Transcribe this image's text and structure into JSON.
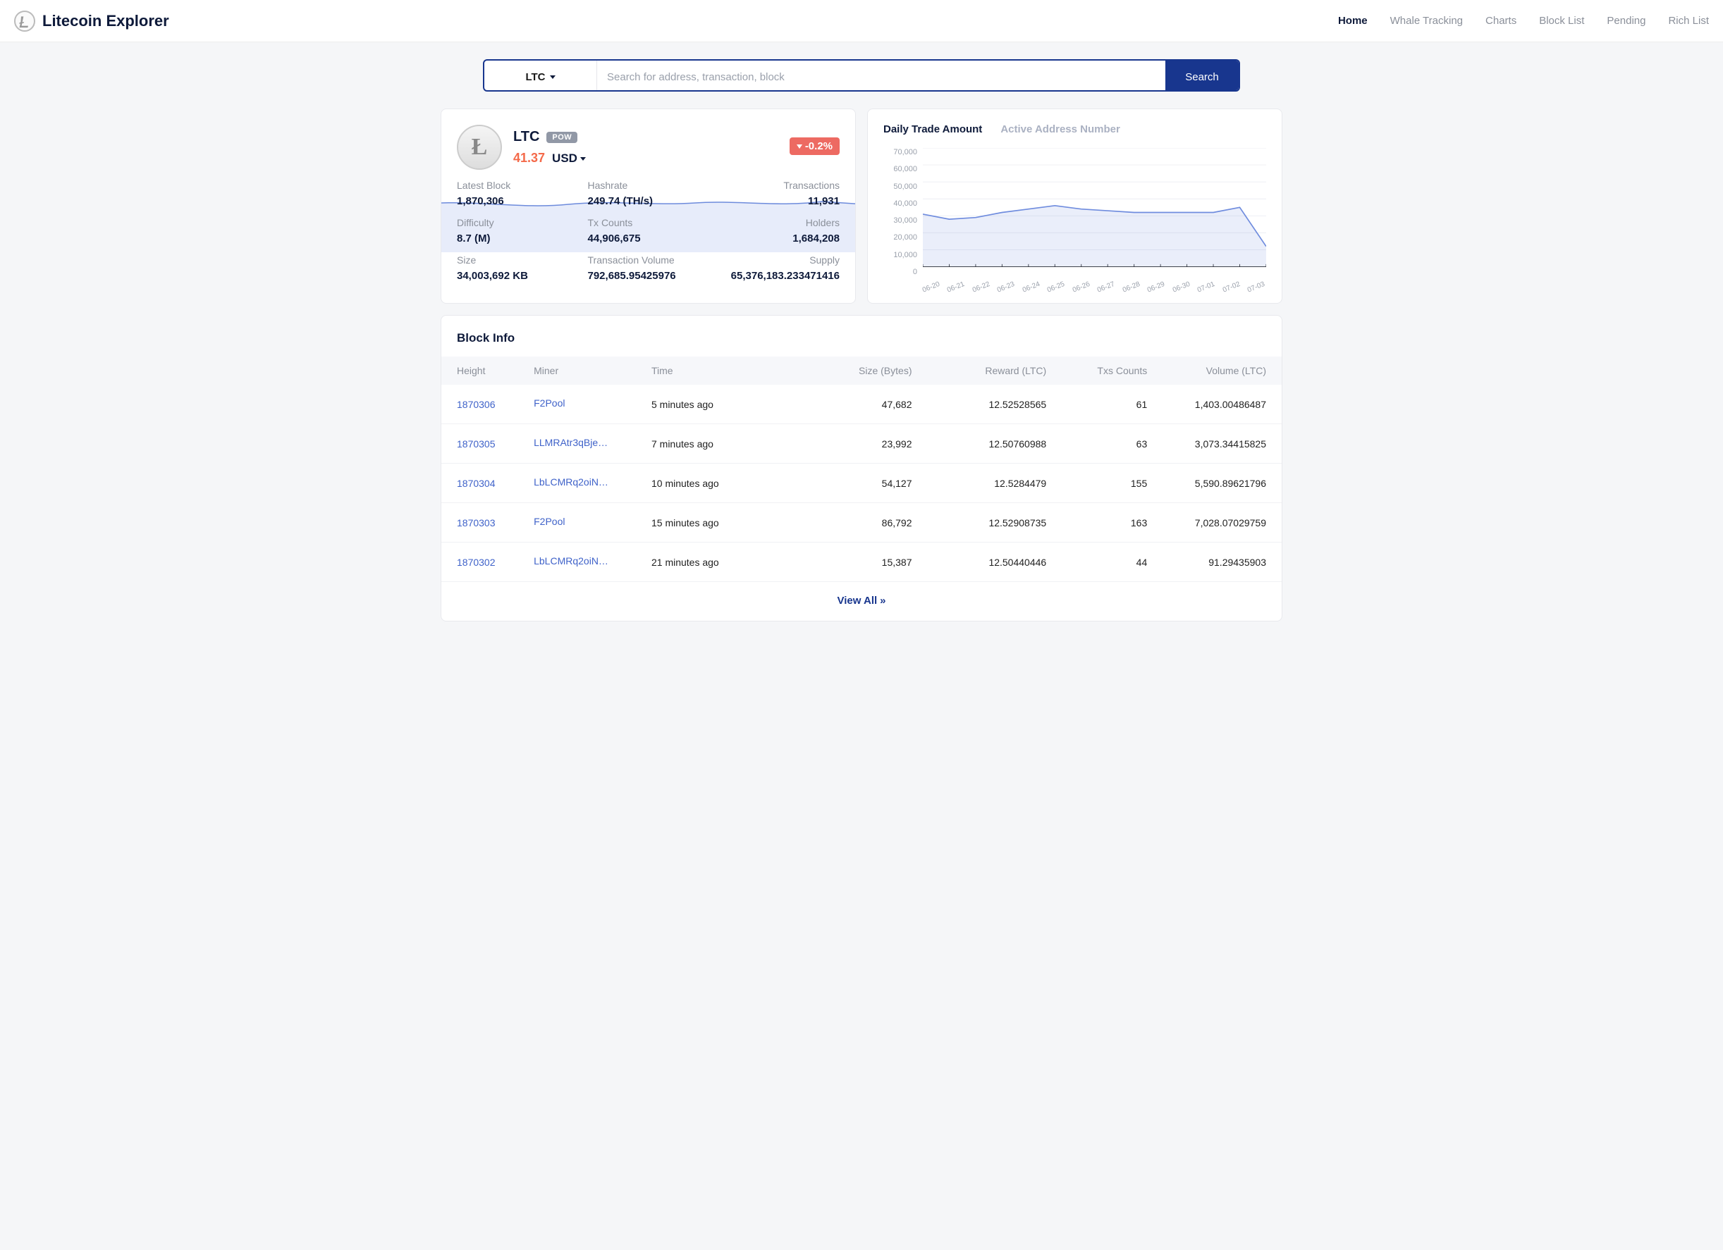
{
  "header": {
    "title": "Litecoin Explorer",
    "nav": [
      {
        "label": "Home",
        "active": true
      },
      {
        "label": "Whale Tracking",
        "active": false
      },
      {
        "label": "Charts",
        "active": false
      },
      {
        "label": "Block List",
        "active": false
      },
      {
        "label": "Pending",
        "active": false
      },
      {
        "label": "Rich List",
        "active": false
      }
    ]
  },
  "search": {
    "coin": "LTC",
    "placeholder": "Search for address, transaction, block",
    "button": "Search"
  },
  "coin": {
    "symbol": "LTC",
    "badge": "POW",
    "price": "41.37",
    "currency": "USD",
    "pct_change": "-0.2%"
  },
  "stats": [
    {
      "label": "Latest Block",
      "value": "1,870,306"
    },
    {
      "label": "Hashrate",
      "value": "249.74 (TH/s)"
    },
    {
      "label": "Transactions",
      "value": "11,931"
    },
    {
      "label": "Difficulty",
      "value": "8.7 (M)"
    },
    {
      "label": "Tx Counts",
      "value": "44,906,675"
    },
    {
      "label": "Holders",
      "value": "1,684,208"
    },
    {
      "label": "Size",
      "value": "34,003,692 KB"
    },
    {
      "label": "Transaction Volume",
      "value": "792,685.95425976"
    },
    {
      "label": "Supply",
      "value": "65,376,183.233471416"
    }
  ],
  "chart_tabs": {
    "active": "Daily Trade Amount",
    "inactive": "Active Address Number"
  },
  "chart_data": {
    "type": "area",
    "ylim": [
      0,
      70000
    ],
    "yticks": [
      "70,000",
      "60,000",
      "50,000",
      "40,000",
      "30,000",
      "20,000",
      "10,000",
      "0"
    ],
    "categories": [
      "06-20",
      "06-21",
      "06-22",
      "06-23",
      "06-24",
      "06-25",
      "06-26",
      "06-27",
      "06-28",
      "06-29",
      "06-30",
      "07-01",
      "07-02",
      "07-03"
    ],
    "series": [
      {
        "name": "Daily Trade Amount",
        "values": [
          31000,
          28000,
          29000,
          32000,
          34000,
          36000,
          34000,
          33000,
          32000,
          32000,
          32000,
          32000,
          35000,
          12000
        ]
      }
    ]
  },
  "block_info": {
    "title": "Block Info",
    "columns": [
      "Height",
      "Miner",
      "Time",
      "Size (Bytes)",
      "Reward (LTC)",
      "Txs Counts",
      "Volume (LTC)"
    ],
    "rows": [
      {
        "height": "1870306",
        "miner": "F2Pool",
        "time": "5 minutes ago",
        "size": "47,682",
        "reward": "12.52528565",
        "txs": "61",
        "volume": "1,403.00486487"
      },
      {
        "height": "1870305",
        "miner": "LLMRAtr3qBje…",
        "time": "7 minutes ago",
        "size": "23,992",
        "reward": "12.50760988",
        "txs": "63",
        "volume": "3,073.34415825"
      },
      {
        "height": "1870304",
        "miner": "LbLCMRq2oiN…",
        "time": "10 minutes ago",
        "size": "54,127",
        "reward": "12.5284479",
        "txs": "155",
        "volume": "5,590.89621796"
      },
      {
        "height": "1870303",
        "miner": "F2Pool",
        "time": "15 minutes ago",
        "size": "86,792",
        "reward": "12.52908735",
        "txs": "163",
        "volume": "7,028.07029759"
      },
      {
        "height": "1870302",
        "miner": "LbLCMRq2oiN…",
        "time": "21 minutes ago",
        "size": "15,387",
        "reward": "12.50440446",
        "txs": "44",
        "volume": "91.29435903"
      }
    ],
    "view_all": "View All"
  }
}
